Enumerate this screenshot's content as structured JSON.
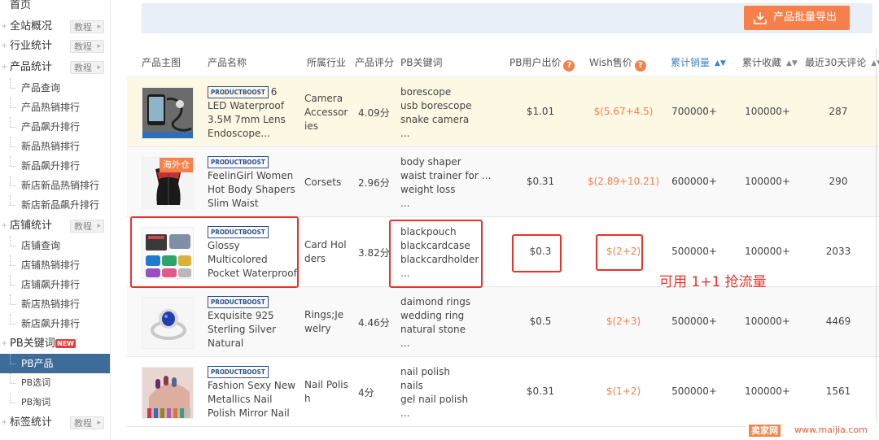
{
  "sidebar": {
    "items": [
      {
        "label": "首页",
        "level": 0
      },
      {
        "label": "全站概况",
        "level": 0,
        "tutorial": "教程"
      },
      {
        "label": "行业统计",
        "level": 0,
        "tutorial": "教程"
      },
      {
        "label": "产品统计",
        "level": 0,
        "tutorial": "教程"
      },
      {
        "label": "产品查询",
        "level": 1
      },
      {
        "label": "产品热销排行",
        "level": 1
      },
      {
        "label": "产品飙升排行",
        "level": 1
      },
      {
        "label": "新品热销排行",
        "level": 1
      },
      {
        "label": "新品飙升排行",
        "level": 1
      },
      {
        "label": "新店新品热销排行",
        "level": 1
      },
      {
        "label": "新店新品飙升排行",
        "level": 1
      },
      {
        "label": "店铺统计",
        "level": 0,
        "tutorial": "教程"
      },
      {
        "label": "店铺查询",
        "level": 1
      },
      {
        "label": "店铺热销排行",
        "level": 1
      },
      {
        "label": "店铺飙升排行",
        "level": 1
      },
      {
        "label": "新店热销排行",
        "level": 1
      },
      {
        "label": "新店飙升排行",
        "level": 1
      },
      {
        "label": "PB关键词",
        "level": 0,
        "badge": "NEW"
      },
      {
        "label": "PB产品",
        "level": 1,
        "active": true
      },
      {
        "label": "PB选词",
        "level": 1
      },
      {
        "label": "PB淘词",
        "level": 1
      },
      {
        "label": "标签统计",
        "level": 0,
        "tutorial": "教程"
      }
    ]
  },
  "toolbar": {
    "export_label": "产品批量导出"
  },
  "table": {
    "headers": {
      "image": "产品主图",
      "name": "产品名称",
      "industry": "所属行业",
      "rating": "产品评分",
      "keywords": "PB关键词",
      "pb_bid": "PB用户出价",
      "wish_price": "Wish售价",
      "sales": "累计销量",
      "favorites": "累计收藏",
      "reviews": "最近30天评论"
    },
    "pb_logo": "PRODUCTBOOST",
    "rows": [
      {
        "name": "6 LED Waterproof 3.5M 7mm Lens Endoscope...",
        "industry": "Camera Accessories",
        "rating": "4.09分",
        "keywords": [
          "borescope",
          "usb borescope",
          "snake camera",
          "..."
        ],
        "pb_bid": "$1.01",
        "wish_price": "$(5.67+4.5)",
        "sales": "700000+",
        "favorites": "100000+",
        "reviews": "287",
        "thumb": "endoscope"
      },
      {
        "name": "FeelinGirl Women Hot Body Shapers Slim Waist Tummy...",
        "industry": "Corsets",
        "rating": "2.96分",
        "keywords": [
          "body shaper",
          "waist trainer for wo...",
          "weight loss",
          "..."
        ],
        "pb_bid": "$0.31",
        "wish_price": "$(2.89+10.21)",
        "sales": "600000+",
        "favorites": "100000+",
        "reviews": "290",
        "thumb": "corset",
        "oversea": "海外仓"
      },
      {
        "name": "Glossy Multicolored Pocket Waterproof Wallet Business ID Credit...",
        "industry": "Card Holders",
        "rating": "3.82分",
        "keywords": [
          "blackpouch",
          "blackcardcase",
          "blackcardholder",
          "..."
        ],
        "pb_bid": "$0.3",
        "wish_price": "$(2+2)",
        "sales": "500000+",
        "favorites": "100000+",
        "reviews": "2033",
        "thumb": "wallet"
      },
      {
        "name": "Exquisite 925 Sterling Silver Natural Sapphire...",
        "industry": "Rings;Jewelry",
        "rating": "4.46分",
        "keywords": [
          "daimond rings",
          "wedding ring",
          "natural stone",
          "..."
        ],
        "pb_bid": "$0.5",
        "wish_price": "$(2+3)",
        "sales": "500000+",
        "favorites": "100000+",
        "reviews": "4469",
        "thumb": "ring"
      },
      {
        "name": "Fashion Sexy New Metallics Nail Polish Mirror Nail Polish",
        "industry": "Nail Polish",
        "rating": "4分",
        "keywords": [
          "nail polish",
          "nails",
          "gel nail polish",
          "..."
        ],
        "pb_bid": "$0.31",
        "wish_price": "$(1+2)",
        "sales": "500000+",
        "favorites": "100000+",
        "reviews": "1561",
        "thumb": "nails"
      }
    ]
  },
  "annotation": "可用 1+1 抢流量",
  "watermark": {
    "logo": "卖家网",
    "url": "www.maijia.com"
  },
  "colors": {
    "accent": "#f7804a",
    "active_nav": "#3e6c99",
    "link_blue": "#3e84c8",
    "highlight_row": "#fdf8e3",
    "annotation_red": "#e8332a"
  }
}
